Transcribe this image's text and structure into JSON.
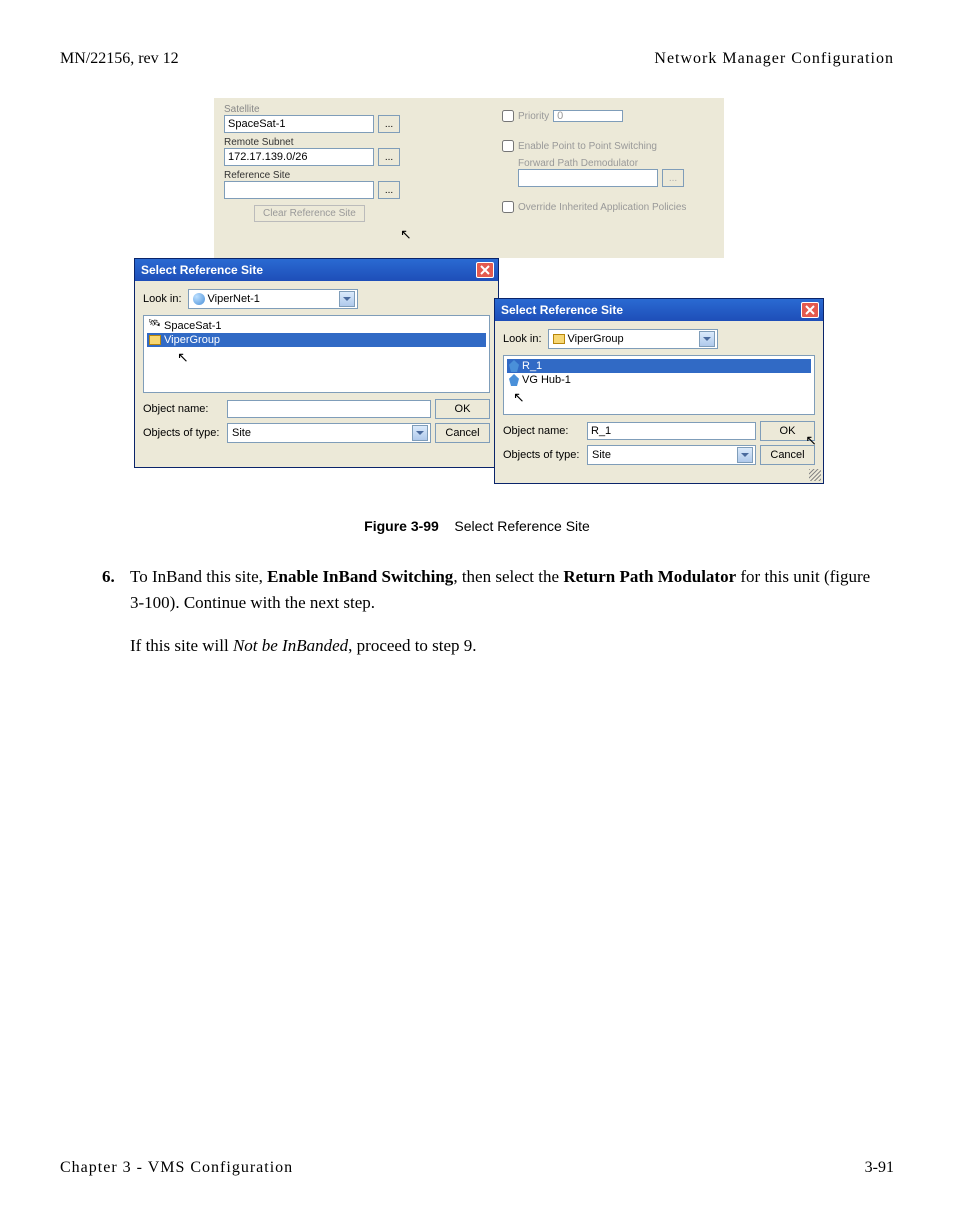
{
  "header": {
    "left": "MN/22156, rev 12",
    "right": "Network Manager Configuration"
  },
  "panel_top": {
    "satellite_label": "Satellite",
    "satellite_value": "SpaceSat-1",
    "remote_subnet_label": "Remote Subnet",
    "remote_subnet_value": "172.17.139.0/26",
    "reference_site_label": "Reference Site",
    "reference_site_value": "",
    "clear_reference_button": "Clear Reference Site",
    "priority_label": "Priority",
    "priority_value": "0",
    "enable_p2p_label": "Enable Point to Point Switching",
    "forward_path_label": "Forward Path Demodulator",
    "forward_path_value": "",
    "override_policies_label": "Override Inherited Application Policies"
  },
  "dialog1": {
    "title": "Select Reference Site",
    "lookin_label": "Look in:",
    "lookin_value": "ViperNet-1",
    "items": [
      "SpaceSat-1",
      "ViperGroup"
    ],
    "selected_index": 1,
    "object_name_label": "Object name:",
    "object_name_value": "",
    "objects_of_type_label": "Objects of type:",
    "objects_of_type_value": "Site",
    "ok": "OK",
    "cancel": "Cancel"
  },
  "dialog2": {
    "title": "Select Reference Site",
    "lookin_label": "Look in:",
    "lookin_value": "ViperGroup",
    "items": [
      "R_1",
      "VG Hub-1"
    ],
    "selected_index": 0,
    "object_name_label": "Object name:",
    "object_name_value": "R_1",
    "objects_of_type_label": "Objects of type:",
    "objects_of_type_value": "Site",
    "ok": "OK",
    "cancel": "Cancel"
  },
  "figure_caption": {
    "number": "Figure 3-99",
    "text": "Select Reference Site"
  },
  "body": {
    "step_num": "6.",
    "para1_a": "To InBand this site, ",
    "para1_b": "Enable InBand Switching",
    "para1_c": ", then select the ",
    "para1_d": "Return Path Modulator",
    "para1_e": " for this unit (figure 3-100). Continue with the next step.",
    "para2_a": "If this site will ",
    "para2_b": "Not be InBanded",
    "para2_c": ", proceed to step 9."
  },
  "footer": {
    "left": "Chapter 3 - VMS Configuration",
    "right": "3-91"
  }
}
